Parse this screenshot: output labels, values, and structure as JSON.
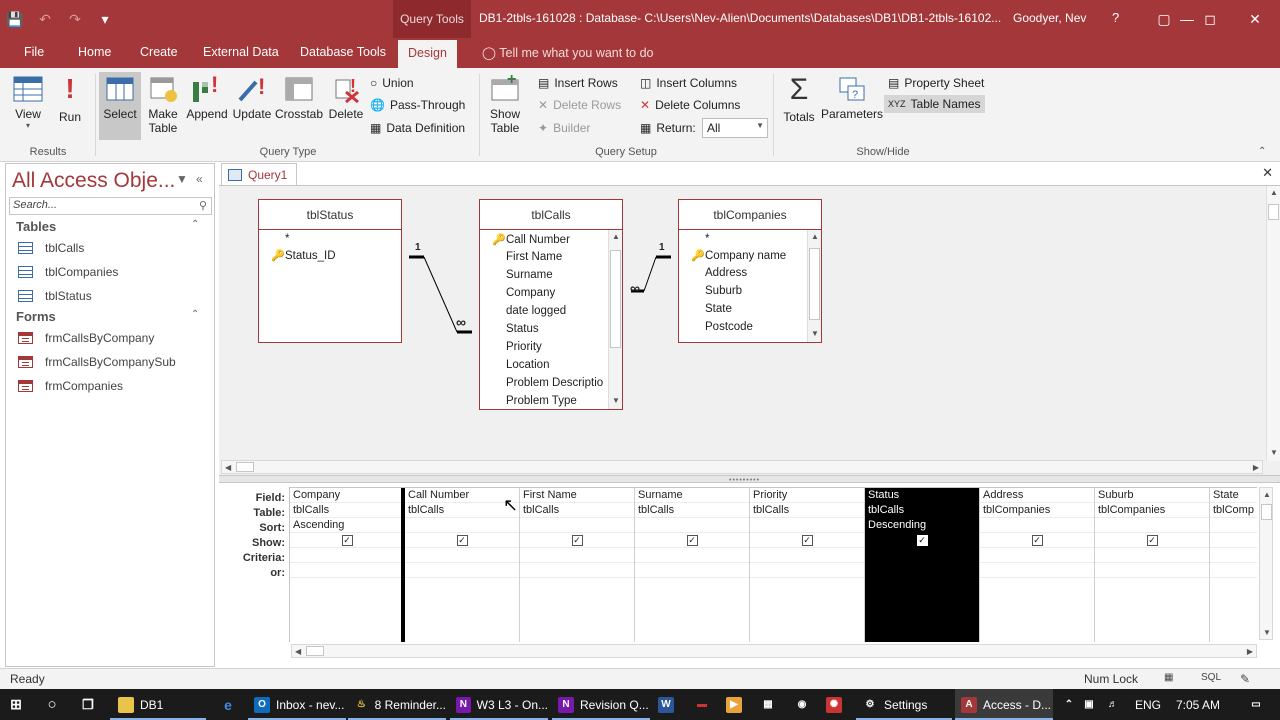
{
  "titlebar": {
    "context_tab": "Query Tools",
    "title": "DB1-2tbls-161028 : Database- C:\\Users\\Nev-Alien\\Documents\\Databases\\DB1\\DB1-2tbls-16102...",
    "user": "Goodyer, Nev",
    "help": "?"
  },
  "tabs": {
    "file": "File",
    "home": "Home",
    "create": "Create",
    "external": "External Data",
    "dbtools": "Database Tools",
    "design": "Design",
    "tellme": "Tell me what you want to do"
  },
  "ribbon": {
    "view": "View",
    "run": "Run",
    "select": "Select",
    "make_table_1": "Make",
    "make_table_2": "Table",
    "append": "Append",
    "update": "Update",
    "crosstab": "Crosstab",
    "delete": "Delete",
    "union": "Union",
    "pass_through": "Pass-Through",
    "data_definition": "Data Definition",
    "show_table_1": "Show",
    "show_table_2": "Table",
    "insert_rows": "Insert Rows",
    "delete_rows": "Delete Rows",
    "builder": "Builder",
    "insert_columns": "Insert Columns",
    "delete_columns": "Delete Columns",
    "return_label": "Return:",
    "return_value": "All",
    "totals": "Totals",
    "parameters": "Parameters",
    "property_sheet": "Property Sheet",
    "table_names": "Table Names",
    "groups": {
      "results": "Results",
      "query_type": "Query Type",
      "query_setup": "Query Setup",
      "show_hide": "Show/Hide"
    }
  },
  "nav": {
    "title": "All Access Obje...",
    "search_placeholder": "Search...",
    "sections": [
      {
        "label": "Tables",
        "items": [
          "tblCalls",
          "tblCompanies",
          "tblStatus"
        ]
      },
      {
        "label": "Forms",
        "items": [
          "frmCallsByCompany",
          "frmCallsByCompanySub",
          "frmCompanies"
        ]
      }
    ]
  },
  "doc": {
    "tab": "Query1",
    "tables": [
      {
        "name": "tblStatus",
        "fields": [
          "*",
          "Status_ID"
        ],
        "keys": [
          1
        ]
      },
      {
        "name": "tblCalls",
        "fields": [
          "Call Number",
          "First Name",
          "Surname",
          "Company",
          "date logged",
          "Status",
          "Priority",
          "Location",
          "Problem Descriptio",
          "Problem Type"
        ],
        "keys": [
          0
        ]
      },
      {
        "name": "tblCompanies",
        "fields": [
          "*",
          "Company name",
          "Address",
          "Suburb",
          "State",
          "Postcode"
        ],
        "keys": [
          1
        ]
      }
    ],
    "relations": {
      "one": "1",
      "many": "∞"
    }
  },
  "grid": {
    "row_labels": [
      "Field:",
      "Table:",
      "Sort:",
      "Show:",
      "Criteria:",
      "or:"
    ],
    "columns": [
      {
        "field": "Company",
        "table": "tblCalls",
        "sort": "Ascending",
        "show": true
      },
      {
        "field": "Call Number",
        "table": "tblCalls",
        "sort": "",
        "show": true
      },
      {
        "field": "First Name",
        "table": "tblCalls",
        "sort": "",
        "show": true
      },
      {
        "field": "Surname",
        "table": "tblCalls",
        "sort": "",
        "show": true
      },
      {
        "field": "Priority",
        "table": "tblCalls",
        "sort": "",
        "show": true
      },
      {
        "field": "Status",
        "table": "tblCalls",
        "sort": "Descending",
        "show": true
      },
      {
        "field": "Address",
        "table": "tblCompanies",
        "sort": "",
        "show": true
      },
      {
        "field": "Suburb",
        "table": "tblCompanies",
        "sort": "",
        "show": true
      },
      {
        "field": "State",
        "table": "tblComp",
        "sort": "",
        "show": false
      }
    ]
  },
  "statusbar": {
    "ready": "Ready",
    "numlock": "Num Lock",
    "sql": "SQL"
  },
  "taskbar": {
    "items": [
      "DB1",
      "Inbox - nev...",
      "8 Reminder...",
      "W3 L3 - On...",
      "Revision Q...",
      "Settings",
      "Access - D..."
    ],
    "lang": "ENG",
    "time": "7:05 AM"
  },
  "colors": {
    "accent": "#a4373a",
    "ribbon": "#f3f3f3",
    "taskbar": "#1b1b1b"
  }
}
